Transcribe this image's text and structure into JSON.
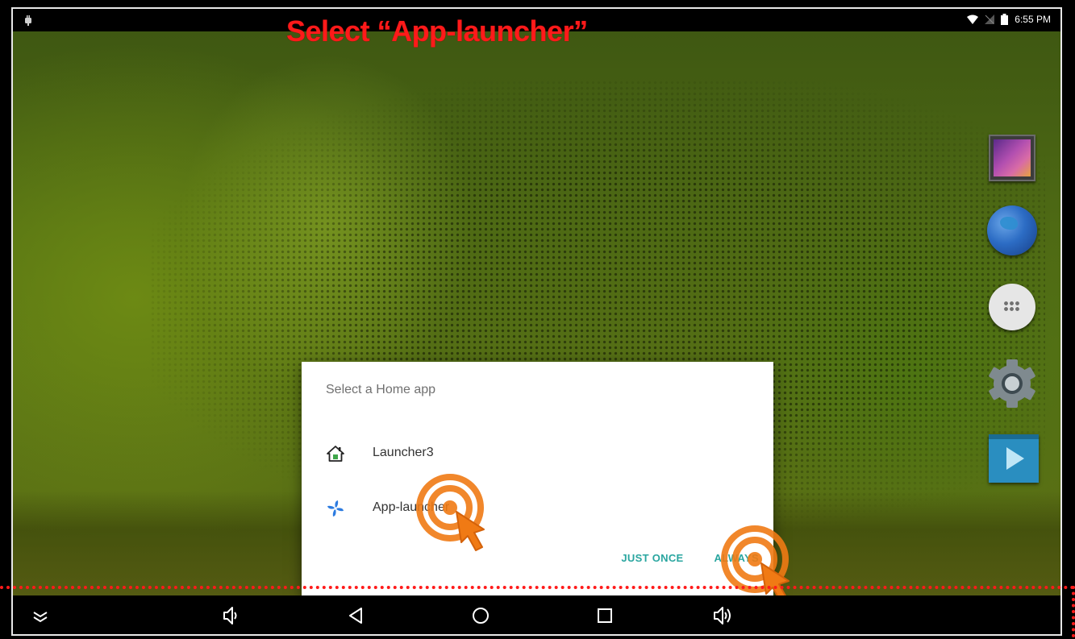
{
  "annotation": {
    "title": "Select “App-launcher”",
    "color": "#ff1a1a"
  },
  "status_bar": {
    "left_icon": "android-debug-icon",
    "icons": [
      "wifi-icon",
      "signal-icon",
      "battery-icon"
    ],
    "time": "6:55 PM"
  },
  "dock": {
    "items": [
      {
        "name": "gallery-icon"
      },
      {
        "name": "browser-icon"
      },
      {
        "name": "all-apps-icon"
      },
      {
        "name": "settings-icon"
      },
      {
        "name": "play-store-icon"
      }
    ]
  },
  "dialog": {
    "title": "Select a Home app",
    "options": [
      {
        "label": "Launcher3",
        "icon": "home-icon"
      },
      {
        "label": "App-launcher",
        "icon": "pinwheel-icon"
      }
    ],
    "buttons": {
      "just_once": "JUST ONCE",
      "always": "ALWAYS"
    },
    "accent_color": "#2aa6a0"
  },
  "nav_bar": {
    "buttons": [
      {
        "name": "hide-bar-icon"
      },
      {
        "name": "volume-down-icon"
      },
      {
        "name": "back-icon"
      },
      {
        "name": "home-icon"
      },
      {
        "name": "recents-icon"
      },
      {
        "name": "volume-up-icon"
      }
    ]
  },
  "colors": {
    "tap_marker": "#f07a14",
    "highlight": "#ff1a1a"
  }
}
